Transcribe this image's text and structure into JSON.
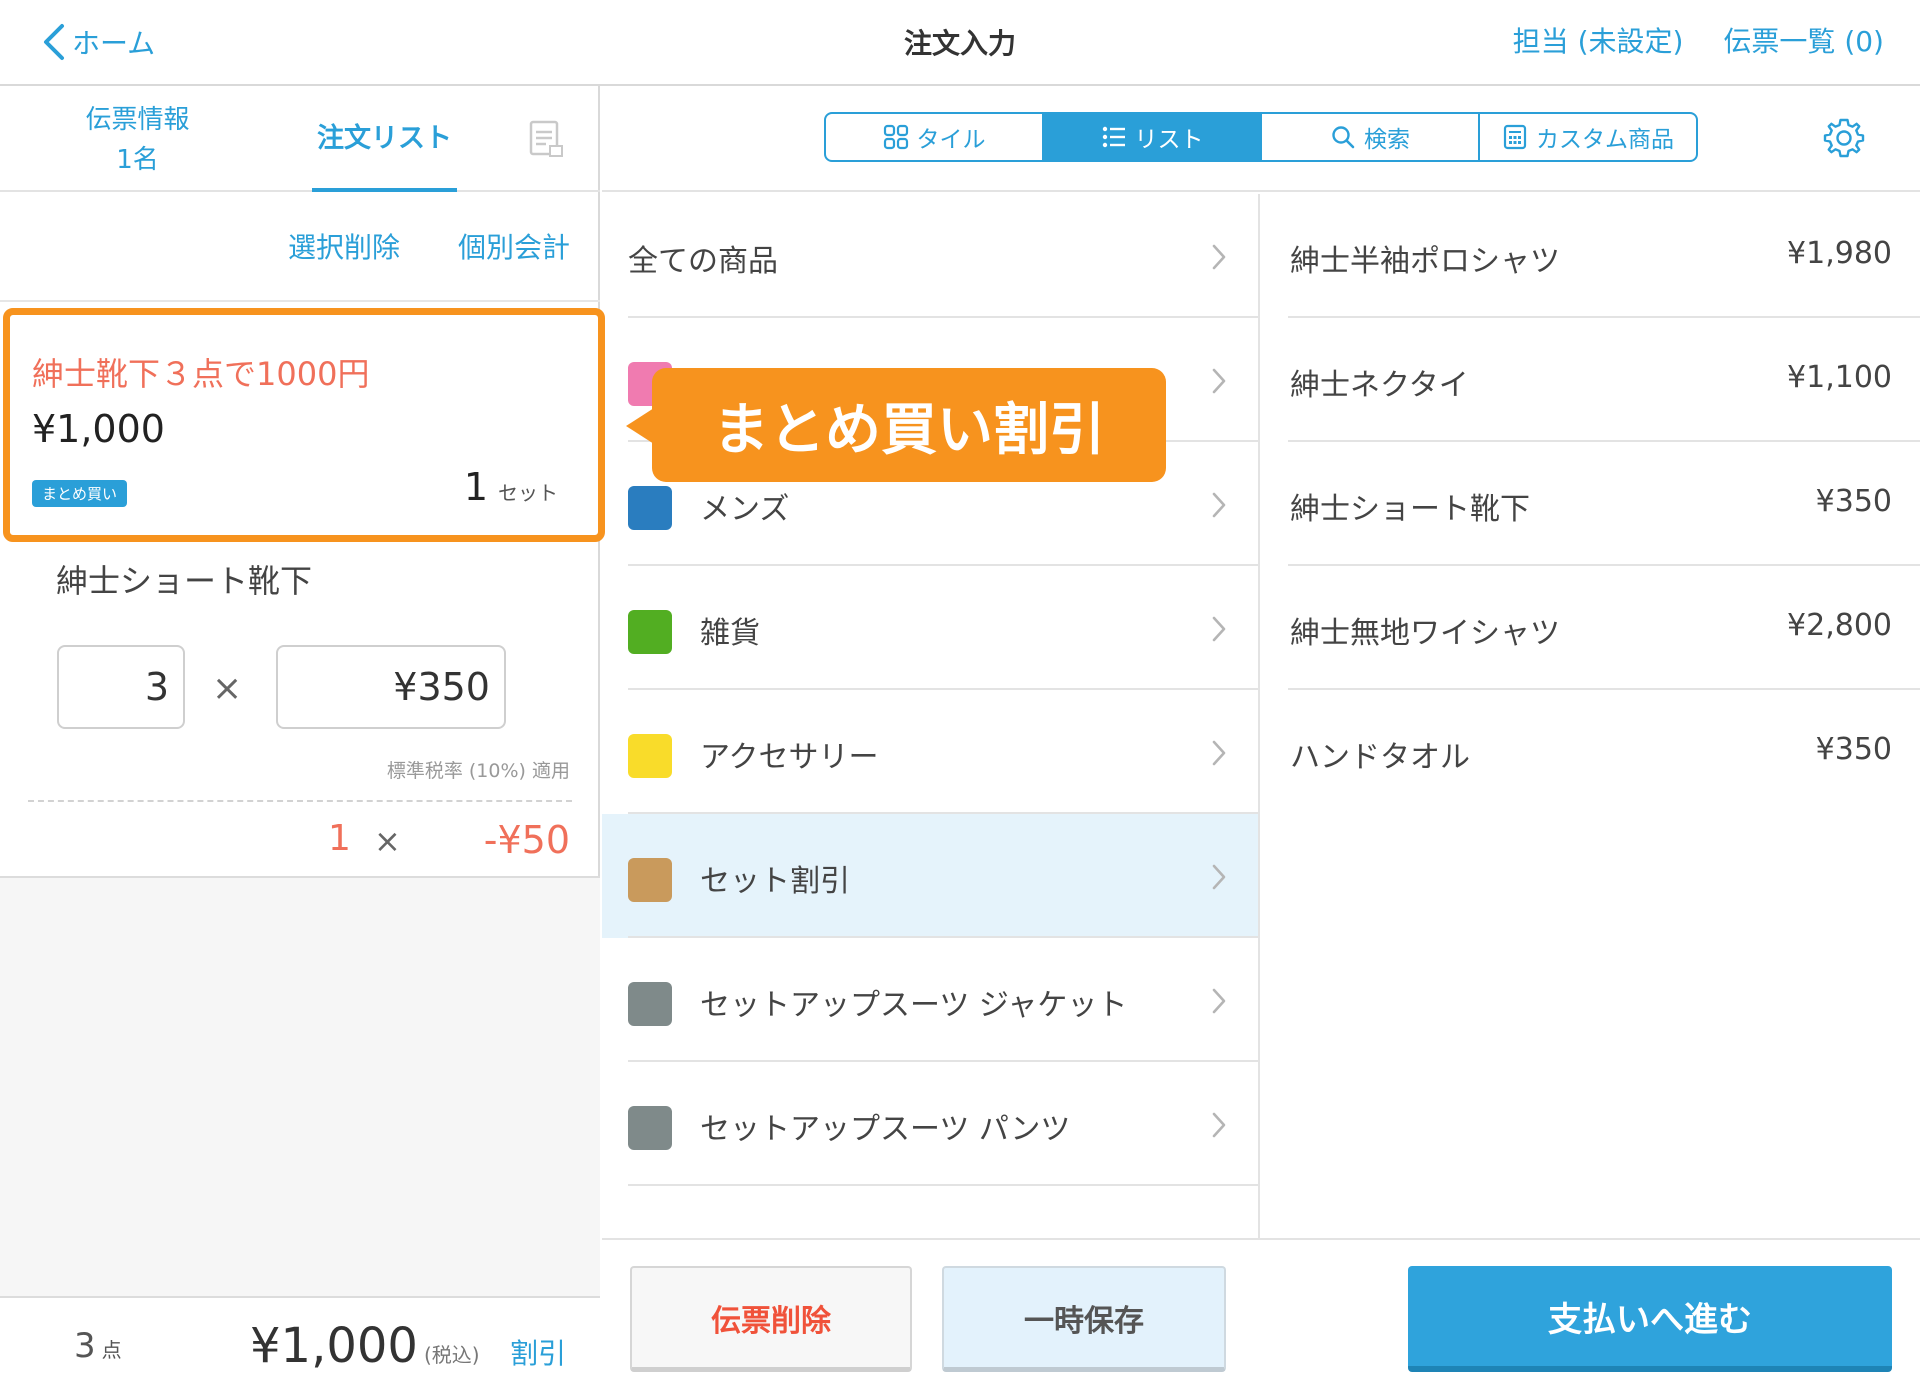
{
  "header": {
    "back_label": "ホーム",
    "title": "注文入力",
    "staff_label": "担当 (未設定)",
    "slip_list_label": "伝票一覧 (0)"
  },
  "left_tabs": {
    "info_label": "伝票情報",
    "info_count": "1名",
    "order_list_label": "注文リスト"
  },
  "left_actions": {
    "select_delete": "選択削除",
    "individual_checkout": "個別会計"
  },
  "discount_card": {
    "name": "紳士靴下３点で1000円",
    "price": "¥1,000",
    "badge": "まとめ買い",
    "qty": "1",
    "unit": "セット"
  },
  "order_item": {
    "name": "紳士ショート靴下",
    "qty": "3",
    "times": "×",
    "price": "¥350",
    "tax_note": "標準税率 (10%) 適用",
    "discount_qty": "1",
    "discount_value": "-¥50"
  },
  "footer": {
    "count": "3",
    "count_unit": "点",
    "total": "¥1,000",
    "tax_label": "(税込)",
    "discount_label": "割引"
  },
  "view_modes": {
    "tile": "タイル",
    "list": "リスト",
    "search": "検索",
    "custom": "カスタム商品",
    "active": "list"
  },
  "categories": [
    {
      "label": "全ての商品",
      "color": null
    },
    {
      "label": "",
      "color": "#f07bb0"
    },
    {
      "label": "メンズ",
      "color": "#2a7dbf"
    },
    {
      "label": "雑貨",
      "color": "#52ae22"
    },
    {
      "label": "アクセサリー",
      "color": "#f9dc2a"
    },
    {
      "label": "セット割引",
      "color": "#c99a5c",
      "active": true
    },
    {
      "label": "セットアップスーツ ジャケット",
      "color": "#7f8a8a"
    },
    {
      "label": "セットアップスーツ パンツ",
      "color": "#7f8a8a"
    }
  ],
  "products": [
    {
      "name": "紳士半袖ポロシャツ",
      "price": "¥1,980"
    },
    {
      "name": "紳士ネクタイ",
      "price": "¥1,100"
    },
    {
      "name": "紳士ショート靴下",
      "price": "¥350"
    },
    {
      "name": "紳士無地ワイシャツ",
      "price": "¥2,800"
    },
    {
      "name": "ハンドタオル",
      "price": "¥350"
    }
  ],
  "buttons": {
    "delete_slip": "伝票削除",
    "temp_save": "一時保存",
    "proceed_pay": "支払いへ進む"
  },
  "callout": "まとめ買い割引",
  "colors": {
    "accent": "#2a9fd8",
    "highlight": "#f7931e",
    "discount_text": "#f0705a"
  }
}
